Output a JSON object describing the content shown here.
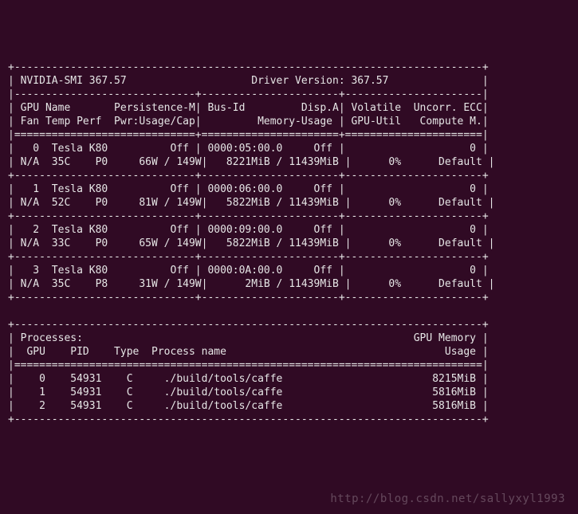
{
  "header": {
    "smi_label": "NVIDIA-SMI",
    "smi_version": "367.57",
    "driver_label": "Driver Version:",
    "driver_version": "367.57"
  },
  "columns": {
    "gpu": "GPU",
    "name": "Name",
    "persistence": "Persistence-M",
    "fan": "Fan",
    "temp": "Temp",
    "perf": "Perf",
    "pwr": "Pwr:Usage/Cap",
    "bus": "Bus-Id",
    "disp": "Disp.A",
    "memuse": "Memory-Usage",
    "volatile": "Volatile",
    "uncorr": "Uncorr. ECC",
    "gpuutil": "GPU-Util",
    "compute": "Compute M."
  },
  "gpus": [
    {
      "idx": "0",
      "name": "Tesla K80",
      "persist": "Off",
      "fan": "N/A",
      "temp": "35C",
      "perf": "P0",
      "pwr_used": "66W",
      "pwr_cap": "149W",
      "bus": "0000:05:00.0",
      "disp": "Off",
      "mem_used": "8221MiB",
      "mem_total": "11439MiB",
      "util": "0%",
      "ecc": "0",
      "compute": "Default"
    },
    {
      "idx": "1",
      "name": "Tesla K80",
      "persist": "Off",
      "fan": "N/A",
      "temp": "52C",
      "perf": "P0",
      "pwr_used": "81W",
      "pwr_cap": "149W",
      "bus": "0000:06:00.0",
      "disp": "Off",
      "mem_used": "5822MiB",
      "mem_total": "11439MiB",
      "util": "0%",
      "ecc": "0",
      "compute": "Default"
    },
    {
      "idx": "2",
      "name": "Tesla K80",
      "persist": "Off",
      "fan": "N/A",
      "temp": "33C",
      "perf": "P0",
      "pwr_used": "65W",
      "pwr_cap": "149W",
      "bus": "0000:09:00.0",
      "disp": "Off",
      "mem_used": "5822MiB",
      "mem_total": "11439MiB",
      "util": "0%",
      "ecc": "0",
      "compute": "Default"
    },
    {
      "idx": "3",
      "name": "Tesla K80",
      "persist": "Off",
      "fan": "N/A",
      "temp": "35C",
      "perf": "P8",
      "pwr_used": "31W",
      "pwr_cap": "149W",
      "bus": "0000:0A:00.0",
      "disp": "Off",
      "mem_used": "2MiB",
      "mem_total": "11439MiB",
      "util": "0%",
      "ecc": "0",
      "compute": "Default"
    }
  ],
  "proc_header": {
    "title": "Processes:",
    "gpu": "GPU",
    "pid": "PID",
    "type": "Type",
    "pname": "Process name",
    "mem1": "GPU Memory",
    "mem2": "Usage"
  },
  "processes": [
    {
      "gpu": "0",
      "pid": "54931",
      "type": "C",
      "name": "./build/tools/caffe",
      "mem": "8215MiB"
    },
    {
      "gpu": "1",
      "pid": "54931",
      "type": "C",
      "name": "./build/tools/caffe",
      "mem": "5816MiB"
    },
    {
      "gpu": "2",
      "pid": "54931",
      "type": "C",
      "name": "./build/tools/caffe",
      "mem": "5816MiB"
    }
  ],
  "watermark": "http://blog.csdn.net/sallyxyl1993",
  "chart_data": {
    "type": "table",
    "title": "nvidia-smi GPU status",
    "gpus": [
      {
        "gpu": 0,
        "name": "Tesla K80",
        "temp_C": 35,
        "perf": "P0",
        "power_W": 66,
        "power_cap_W": 149,
        "mem_used_MiB": 8221,
        "mem_total_MiB": 11439,
        "util_pct": 0
      },
      {
        "gpu": 1,
        "name": "Tesla K80",
        "temp_C": 52,
        "perf": "P0",
        "power_W": 81,
        "power_cap_W": 149,
        "mem_used_MiB": 5822,
        "mem_total_MiB": 11439,
        "util_pct": 0
      },
      {
        "gpu": 2,
        "name": "Tesla K80",
        "temp_C": 33,
        "perf": "P0",
        "power_W": 65,
        "power_cap_W": 149,
        "mem_used_MiB": 5822,
        "mem_total_MiB": 11439,
        "util_pct": 0
      },
      {
        "gpu": 3,
        "name": "Tesla K80",
        "temp_C": 35,
        "perf": "P8",
        "power_W": 31,
        "power_cap_W": 149,
        "mem_used_MiB": 2,
        "mem_total_MiB": 11439,
        "util_pct": 0
      }
    ],
    "processes": [
      {
        "gpu": 0,
        "pid": 54931,
        "type": "C",
        "name": "./build/tools/caffe",
        "mem_MiB": 8215
      },
      {
        "gpu": 1,
        "pid": 54931,
        "type": "C",
        "name": "./build/tools/caffe",
        "mem_MiB": 5816
      },
      {
        "gpu": 2,
        "pid": 54931,
        "type": "C",
        "name": "./build/tools/caffe",
        "mem_MiB": 5816
      }
    ]
  }
}
